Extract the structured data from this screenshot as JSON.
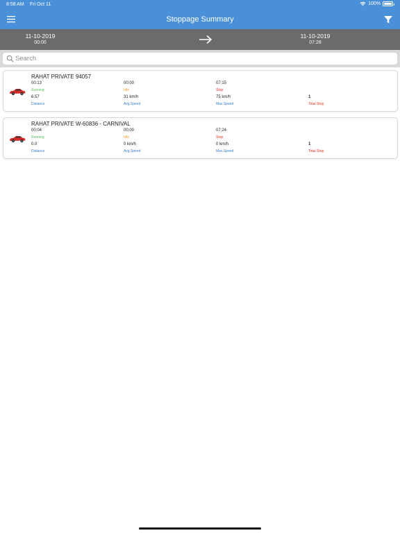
{
  "status_bar": {
    "time": "8:58 AM",
    "date": "Fri Oct 11",
    "battery": "100%"
  },
  "nav": {
    "title": "Stoppage Summary",
    "menu_icon": "hamburger-icon",
    "filter_icon": "filter-icon"
  },
  "date_range": {
    "start_date": "11-10-2019",
    "start_time": "00:00",
    "end_date": "11-10-2019",
    "end_time": "07:28"
  },
  "search": {
    "placeholder": "Search",
    "value": ""
  },
  "colors": {
    "header": "#4a90d9",
    "daterange": "#6b6b6b",
    "running": "#5cb85c",
    "idle": "#f0a030",
    "stop": "#e0301e",
    "label_blue": "#3b7fc4"
  },
  "vehicles": [
    {
      "name": "RAHAT PRIVATE   94057",
      "running": "00:13",
      "running_label": "Running",
      "idle": "00:00",
      "idle_label": "Idle",
      "stop": "07:15",
      "stop_label": "Stop",
      "distance": "6.57",
      "distance_label": "Distance",
      "avg_speed": "31 km/h",
      "avg_speed_label": "Avg.Speed",
      "max_speed": "75 km/h",
      "max_speed_label": "Max.Speed",
      "total_stop": "1",
      "total_stop_label": "Total Stop"
    },
    {
      "name": "RAHAT PRIVATE   W-60836 - CARNIVAL",
      "running": "00:04",
      "running_label": "Running",
      "idle": "00:00",
      "idle_label": "Idle",
      "stop": "07:24",
      "stop_label": "Stop",
      "distance": "0.0",
      "distance_label": "Distance",
      "avg_speed": "0 km/h",
      "avg_speed_label": "Avg.Speed",
      "max_speed": "0 km/h",
      "max_speed_label": "Max.Speed",
      "total_stop": "1",
      "total_stop_label": "Total Stop"
    }
  ]
}
